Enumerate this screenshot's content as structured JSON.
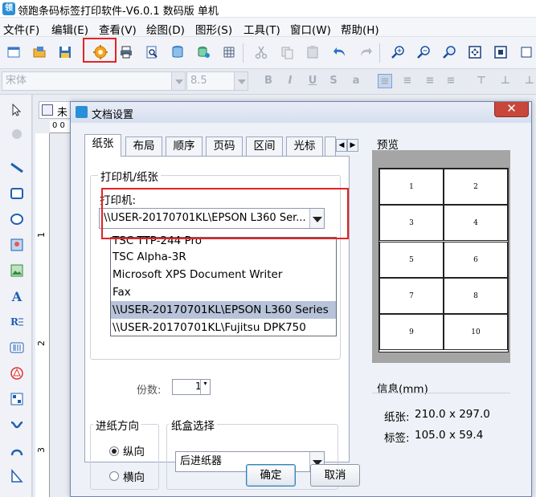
{
  "app": {
    "title": "领跑条码标签打印软件-V6.0.1 数码版 单机"
  },
  "menu": [
    "文件(F)",
    "编辑(E)",
    "查看(V)",
    "绘图(D)",
    "图形(S)",
    "工具(T)",
    "窗口(W)",
    "帮助(H)"
  ],
  "fontbar": {
    "font_name": "宋体",
    "font_size": "8.5"
  },
  "doc_tab_label": "未",
  "ruler_h_label": "0 0",
  "ruler_v_labels": [
    "1",
    "2",
    "3"
  ],
  "dialog": {
    "title": "文档设置",
    "tabs": [
      "纸张",
      "布局",
      "顺序",
      "页码",
      "区间",
      "光标"
    ],
    "printer_group_title": "打印机/纸张",
    "printer_label": "打印机:",
    "printer_value": "\\\\USER-20170701KL\\EPSON L360 Ser...",
    "printer_options": [
      "TSC TTP-244 Pro",
      "TSC Alpha-3R",
      "Microsoft XPS Document Writer",
      "Fax",
      "\\\\USER-20170701KL\\EPSON L360 Series",
      "\\\\USER-20170701KL\\Fujitsu DPK750"
    ],
    "selected_printer_index": 4,
    "copies_label": "份数:",
    "copies_value": "1",
    "feed_group_title": "进纸方向",
    "feed_portrait": "纵向",
    "feed_landscape": "横向",
    "tray_group_title": "纸盒选择",
    "tray_value": "后进纸器",
    "ok_label": "确定",
    "cancel_label": "取消",
    "preview_title": "预览",
    "preview_cells": [
      "1",
      "2",
      "3",
      "4",
      "5",
      "6",
      "7",
      "8",
      "9",
      "10"
    ],
    "info_title": "信息(mm)",
    "paper_label": "纸张:",
    "paper_value": "210.0 x 297.0",
    "label_label": "标签:",
    "label_value": "105.0 x 59.4"
  },
  "colors": {
    "highlight": "#e42323",
    "selected_row": "#b6c3d9"
  }
}
